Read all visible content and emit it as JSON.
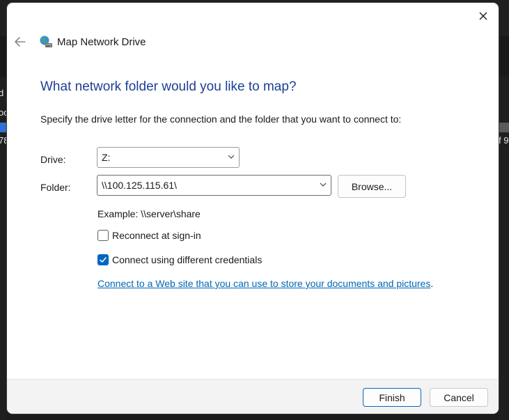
{
  "background": {
    "left_fragments": [
      "d",
      "oc",
      "78"
    ],
    "right_fragment": "f 9"
  },
  "dialog": {
    "title": "Map Network Drive",
    "heading": "What network folder would you like to map?",
    "instructions": "Specify the drive letter for the connection and the folder that you want to connect to:",
    "drive": {
      "label": "Drive:",
      "value": "Z:"
    },
    "folder": {
      "label": "Folder:",
      "value": "\\\\100.125.115.61\\",
      "browse_label": "Browse..."
    },
    "example": "Example: \\\\server\\share",
    "options": {
      "reconnect": {
        "label": "Reconnect at sign-in",
        "checked": false
      },
      "different_credentials": {
        "label": "Connect using different credentials",
        "checked": true
      }
    },
    "web_link": {
      "text": "Connect to a Web site that you can use to store your documents and pictures",
      "suffix": "."
    },
    "footer": {
      "finish_label": "Finish",
      "cancel_label": "Cancel"
    }
  },
  "colors": {
    "heading": "#1c3f94",
    "accent": "#0067c0",
    "link": "#0066b4"
  },
  "icons": [
    "close-icon",
    "back-arrow-icon",
    "network-drive-icon",
    "chevron-down-icon",
    "checkmark-icon"
  ]
}
